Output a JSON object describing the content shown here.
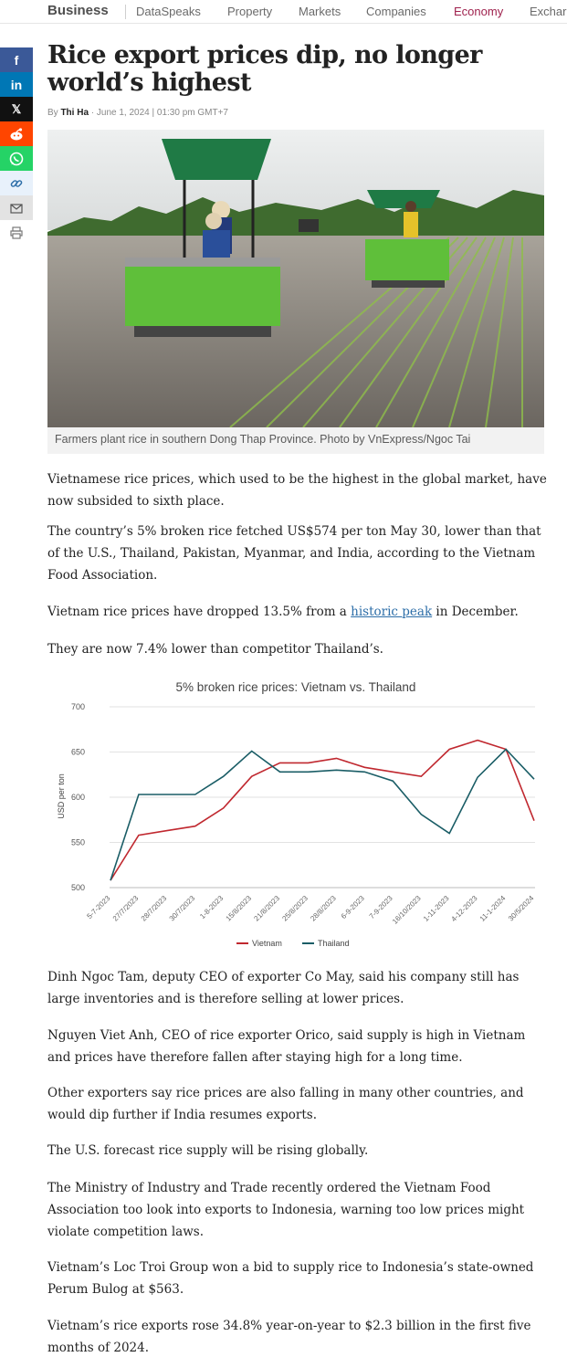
{
  "nav": {
    "brand": "Business",
    "items": [
      "DataSpeaks",
      "Property",
      "Markets",
      "Companies",
      "Economy",
      "Exchar"
    ],
    "active": "Economy"
  },
  "share": {
    "facebook": "f",
    "linkedin": "in",
    "x": "𝕏"
  },
  "article": {
    "title": "Rice export prices dip, no longer world’s highest",
    "by": "By",
    "author": "Thi Ha",
    "datetime": "June 1, 2024 | 01:30 pm GMT+7",
    "caption": "Farmers plant rice in southern Dong Thap Province. Photo by VnExpress/Ngoc Tai",
    "p1": "Vietnamese rice prices, which used to be the highest in the global market, have now subsided to sixth place.",
    "p2": "The country’s 5% broken rice fetched US$574 per ton May 30, lower than that of the U.S., Thailand, Pakistan, Myanmar, and India, according to the Vietnam Food Association.",
    "p3_before": "Vietnam rice prices have dropped 13.5% from a ",
    "p3_link": "historic peak",
    "p3_after": " in December.",
    "p4": "They are now 7.4% lower than competitor Thailand’s.",
    "p5": "Dinh Ngoc Tam, deputy CEO of exporter Co May, said his company still has large inventories and is therefore selling at lower prices.",
    "p6": "Nguyen Viet Anh, CEO of rice exporter Orico, said supply is high in Vietnam and prices have therefore fallen after staying high for a long time.",
    "p7": "Other exporters say rice prices are also falling in many other countries, and would dip further if India resumes exports.",
    "p8": "The U.S. forecast rice supply will be rising globally.",
    "p9": "The Ministry of Industry and Trade recently ordered the Vietnam Food Association too look into exports to Indonesia, warning too low prices might violate competition laws.",
    "p10": "Vietnam’s Loc Troi Group won a bid to supply rice to Indonesia’s state-owned Perum Bulog at $563.",
    "p11": "Vietnam’s rice exports rose 34.8% year-on-year to $2.3 billion in the first five months of 2024."
  },
  "chart_data": {
    "type": "line",
    "title": "5% broken rice prices: Vietnam vs. Thailand",
    "xlabel": "",
    "ylabel": "USD per ton",
    "ylim": [
      500,
      700
    ],
    "yticks": [
      500,
      550,
      600,
      650,
      700
    ],
    "grid": true,
    "legend": "bottom",
    "categories": [
      "5-7-2023",
      "27/7/2023",
      "28/7/2023",
      "30/7/2023",
      "1-8-2023",
      "15/8/2023",
      "21/8/2023",
      "25/8/2023",
      "28/8/2023",
      "6-9-2023",
      "7-9-2023",
      "16/10/2023",
      "1-11-2023",
      "4-12-2023",
      "11-1-2024",
      "30/5/2024"
    ],
    "series": [
      {
        "name": "Vietnam",
        "color": "#c0282f",
        "values": [
          508,
          558,
          563,
          568,
          588,
          623,
          638,
          638,
          643,
          633,
          628,
          623,
          653,
          663,
          653,
          574
        ]
      },
      {
        "name": "Thailand",
        "color": "#1a5d66",
        "values": [
          508,
          603,
          603,
          603,
          623,
          651,
          628,
          628,
          630,
          628,
          618,
          581,
          560,
          622,
          653,
          620
        ]
      }
    ]
  }
}
